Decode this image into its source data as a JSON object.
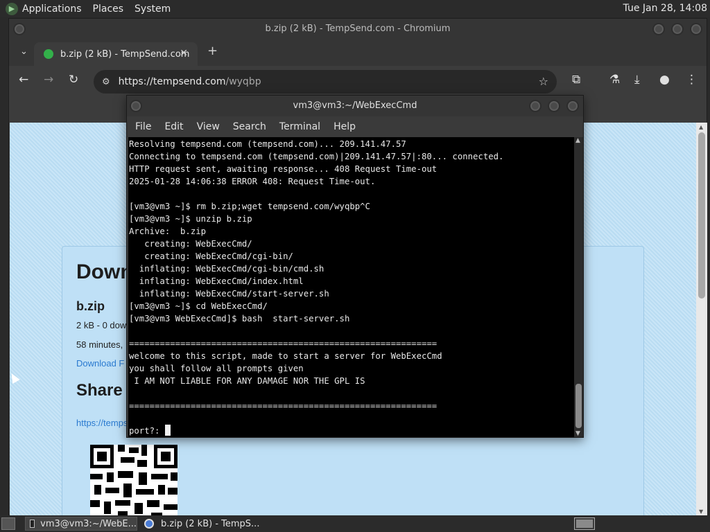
{
  "top_panel": {
    "menus": [
      "Applications",
      "Places",
      "System"
    ],
    "clock": "Tue Jan 28, 14:08"
  },
  "browser": {
    "window_title": "b.zip (2 kB) - TempSend.com - Chromium",
    "tab_title": "b.zip (2 kB) - TempSend.com",
    "url_host": "https://tempsend.com",
    "url_path": "/wyqbp",
    "page": {
      "heading": "Down",
      "filename": "b.zip",
      "meta": "2 kB - 0 dow",
      "expiry": "58 minutes,",
      "download_link": "Download F",
      "share_heading": "Share",
      "share_link": "https://temps"
    }
  },
  "terminal": {
    "title": "vm3@vm3:~/WebExecCmd",
    "menu": [
      "File",
      "Edit",
      "View",
      "Search",
      "Terminal",
      "Help"
    ],
    "lines": [
      "Resolving tempsend.com (tempsend.com)... 209.141.47.57",
      "Connecting to tempsend.com (tempsend.com)|209.141.47.57|:80... connected.",
      "HTTP request sent, awaiting response... 408 Request Time-out",
      "2025-01-28 14:06:38 ERROR 408: Request Time-out.",
      "",
      "[vm3@vm3 ~]$ rm b.zip;wget tempsend.com/wyqbp^C",
      "[vm3@vm3 ~]$ unzip b.zip",
      "Archive:  b.zip",
      "   creating: WebExecCmd/",
      "   creating: WebExecCmd/cgi-bin/",
      "  inflating: WebExecCmd/cgi-bin/cmd.sh",
      "  inflating: WebExecCmd/index.html",
      "  inflating: WebExecCmd/start-server.sh",
      "[vm3@vm3 ~]$ cd WebExecCmd/",
      "[vm3@vm3 WebExecCmd]$ bash  start-server.sh",
      "",
      "============================================================",
      "welcome to this script, made to start a server for WebExecCmd",
      "you shall follow all prompts given",
      " I AM NOT LIABLE FOR ANY DAMAGE NOR THE GPL IS",
      "",
      "============================================================",
      ""
    ],
    "prompt": "port?: "
  },
  "taskbar": {
    "items": [
      "vm3@vm3:~/WebE...",
      "b.zip (2 kB) - TempS..."
    ]
  }
}
